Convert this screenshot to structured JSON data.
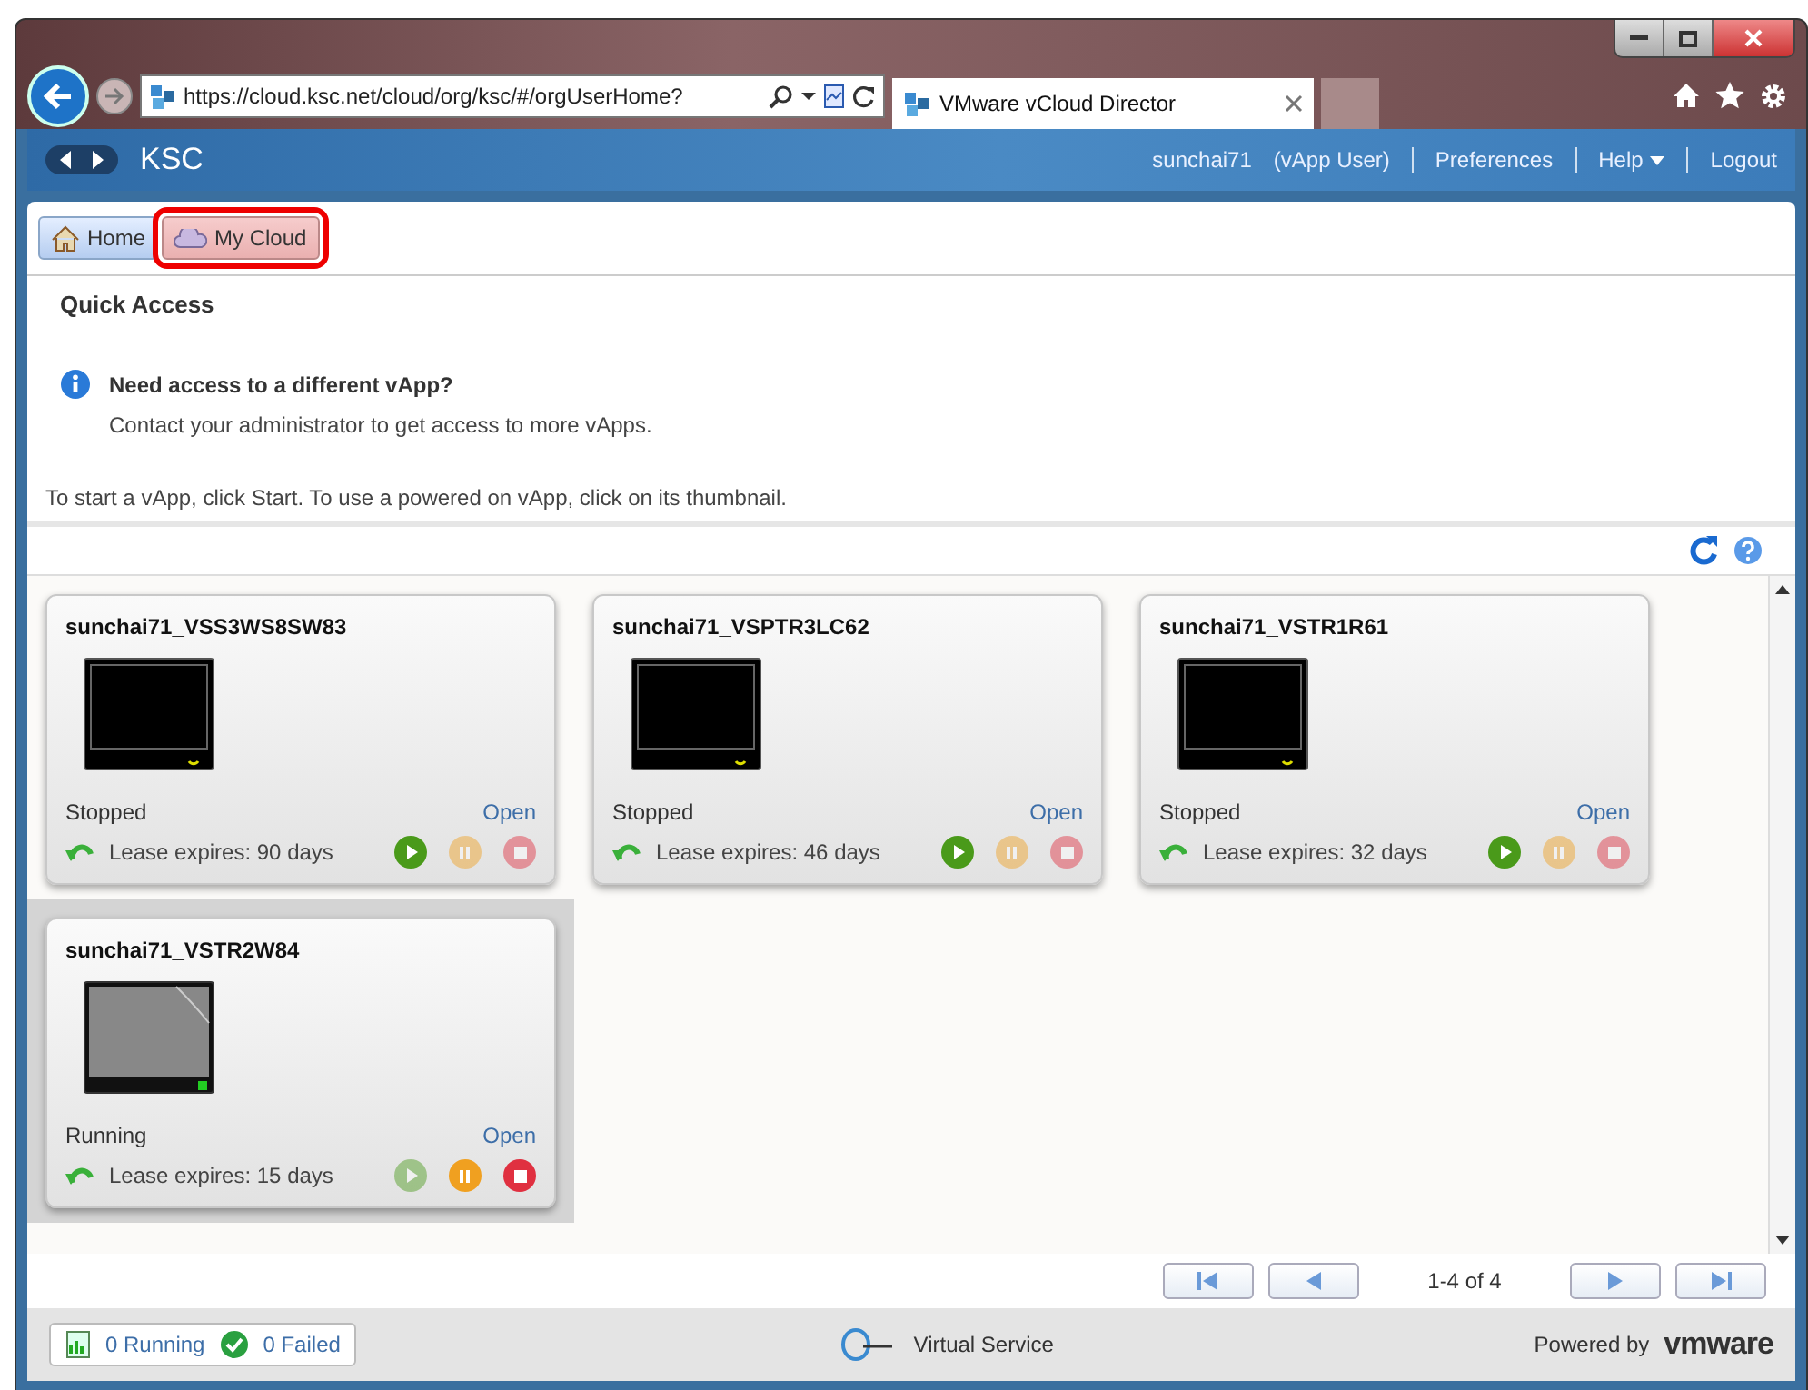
{
  "browser": {
    "address": "https://cloud.ksc.net/cloud/org/ksc/#/orgUserHome?",
    "tab_title": "VMware vCloud Director"
  },
  "header": {
    "title": "KSC",
    "user": "sunchai71",
    "role": "(vApp User)",
    "links": [
      {
        "label": "Preferences",
        "has_menu": false
      },
      {
        "label": "Help",
        "has_menu": true
      },
      {
        "label": "Logout",
        "has_menu": false
      }
    ]
  },
  "breadcrumb": [
    {
      "label": "Home",
      "selected": false
    },
    {
      "label": "My Cloud",
      "selected": true
    }
  ],
  "quick_access": {
    "title": "Quick Access",
    "notice_title": "Need access to a different vApp?",
    "notice_text": "Contact your administrator to get access to more vApps.",
    "instructions": "To start a vApp, click Start. To use a powered on vApp, click on its thumbnail."
  },
  "vapps": [
    {
      "name": "sunchai71_VSS3WS8SW83",
      "status": "Stopped",
      "open_label": "Open",
      "lease": "Lease expires: 90 days",
      "running": false,
      "selected": false
    },
    {
      "name": "sunchai71_VSPTR3LC62",
      "status": "Stopped",
      "open_label": "Open",
      "lease": "Lease expires: 46 days",
      "running": false,
      "selected": false
    },
    {
      "name": "sunchai71_VSTR1R61",
      "status": "Stopped",
      "open_label": "Open",
      "lease": "Lease expires: 32 days",
      "running": false,
      "selected": false
    },
    {
      "name": "sunchai71_VSTR2W84",
      "status": "Running",
      "open_label": "Open",
      "lease": "Lease expires: 15 days",
      "running": true,
      "selected": true
    }
  ],
  "pagination": {
    "range": "1-4 of 4"
  },
  "footer": {
    "running": "0 Running",
    "failed": "0 Failed",
    "service": "Virtual Service",
    "powered_by": "Powered by",
    "brand": "vmware"
  }
}
